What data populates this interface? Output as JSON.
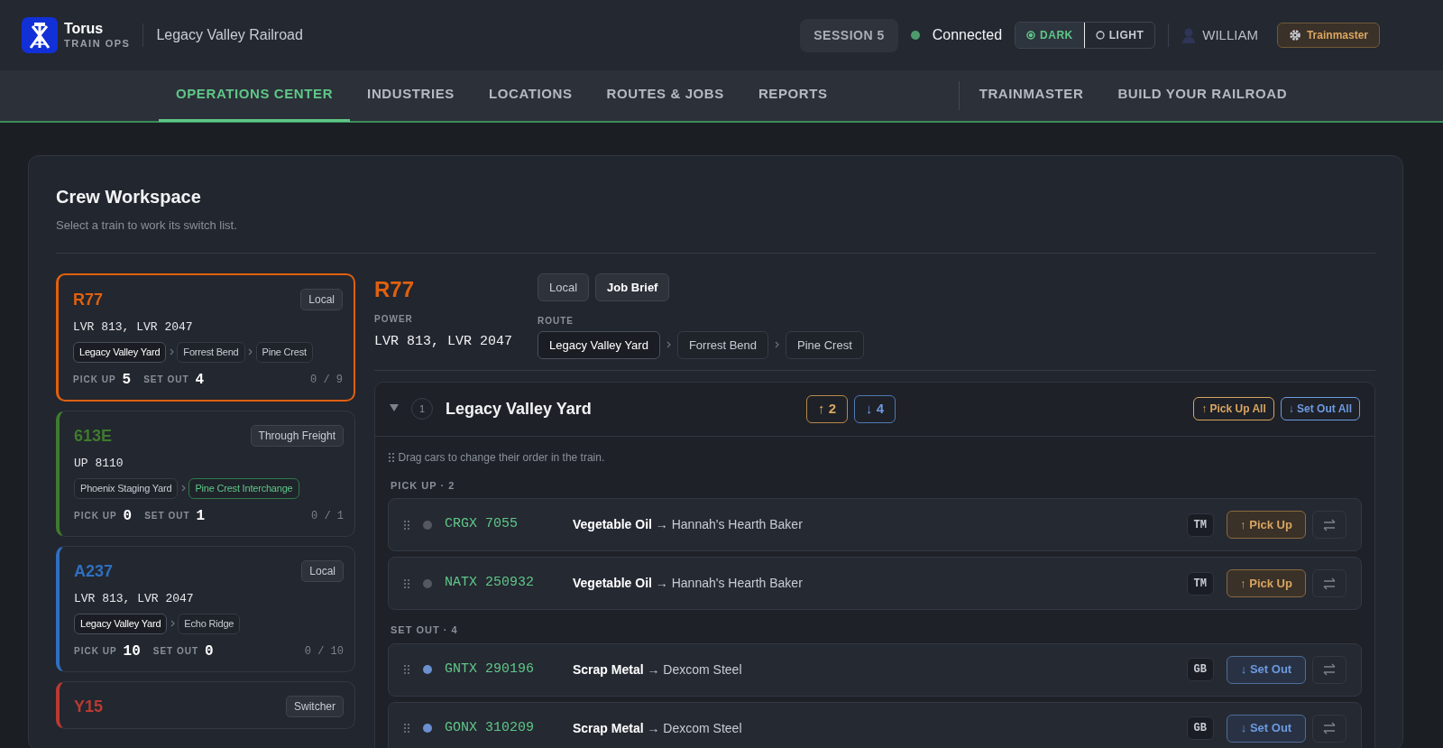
{
  "header": {
    "logo": {
      "title": "Torus",
      "subtitle": "TRAIN OPS"
    },
    "railroad": "Legacy Valley Railroad",
    "session": "SESSION 5",
    "connection": {
      "label": "Connected",
      "on": true
    },
    "theme_toggle": [
      {
        "label": "DARK",
        "selected": true
      },
      {
        "label": "LIGHT",
        "selected": false
      }
    ],
    "user": "WILLIAM",
    "role_button": "Trainmaster"
  },
  "nav": {
    "main": [
      {
        "label": "OPERATIONS CENTER",
        "selected": true
      },
      {
        "label": "INDUSTRIES",
        "selected": false
      },
      {
        "label": "LOCATIONS",
        "selected": false
      },
      {
        "label": "ROUTES & JOBS",
        "selected": false
      },
      {
        "label": "REPORTS",
        "selected": false
      }
    ],
    "admin": [
      {
        "label": "TRAINMASTER",
        "selected": false
      },
      {
        "label": "BUILD YOUR RAILROAD",
        "selected": false
      }
    ]
  },
  "workspace": {
    "title": "Crew Workspace",
    "subtitle": "Select a train to work its switch list."
  },
  "trains": [
    {
      "name": "R77",
      "color": "#e0600f",
      "type": "Local",
      "selected": true,
      "power": "LVR 813, LVR 2047",
      "route": [
        {
          "label": "Legacy Valley Yard",
          "kind": "current"
        },
        {
          "label": "Forrest Bend",
          "kind": "stop"
        },
        {
          "label": "Pine Crest",
          "kind": "stop"
        }
      ],
      "pickup_label": "PICK UP",
      "pickup": "5",
      "setout_label": "SET OUT",
      "setout": "4",
      "progress": "0 / 9"
    },
    {
      "name": "613E",
      "color": "#3f7a2e",
      "type": "Through Freight",
      "selected": false,
      "power": "UP 8110",
      "route": [
        {
          "label": "Phoenix Staging Yard",
          "kind": "stop"
        },
        {
          "label": "Pine Crest Interchange",
          "kind": "interchange"
        }
      ],
      "pickup_label": "PICK UP",
      "pickup": "0",
      "setout_label": "SET OUT",
      "setout": "1",
      "progress": "0 / 1"
    },
    {
      "name": "A237",
      "color": "#2f6fc0",
      "type": "Local",
      "selected": false,
      "power": "LVR 813, LVR 2047",
      "route": [
        {
          "label": "Legacy Valley Yard",
          "kind": "current"
        },
        {
          "label": "Echo Ridge",
          "kind": "stop"
        }
      ],
      "pickup_label": "PICK UP",
      "pickup": "10",
      "setout_label": "SET OUT",
      "setout": "0",
      "progress": "0 / 10"
    },
    {
      "name": "Y15",
      "color": "#b83a32",
      "type": "Switcher",
      "selected": false
    }
  ],
  "detail": {
    "name": "R77",
    "color": "#e0600f",
    "type": "Local",
    "brief_button": "Job Brief",
    "power_label": "POWER",
    "power": "LVR 813, LVR 2047",
    "route_label": "ROUTE",
    "route": [
      {
        "label": "Legacy Valley Yard",
        "kind": "current"
      },
      {
        "label": "Forrest Bend",
        "kind": "stop"
      },
      {
        "label": "Pine Crest",
        "kind": "stop"
      }
    ],
    "stops": [
      {
        "number": "1",
        "name": "Legacy Valley Yard",
        "expanded": true,
        "pickup_count": "↑ 2",
        "setout_count": "↓ 4",
        "pickup_all": "↑ Pick Up All",
        "setout_all": "↓ Set Out All",
        "hint": "Drag cars to change their order in the train.",
        "sections": [
          {
            "kind": "pickup",
            "heading": "PICK UP · 2",
            "cars": [
              {
                "reporting": "CRGX 7055",
                "load": "**Vegetable Oil** → Hannah's Hearth Baker",
                "color": "#55585f",
                "tag": "TM",
                "action": "↑ Pick Up"
              },
              {
                "reporting": "NATX 250932",
                "load": "**Vegetable Oil** → Hannah's Hearth Baker",
                "color": "#55585f",
                "tag": "TM",
                "action": "↑ Pick Up"
              }
            ]
          },
          {
            "kind": "setout",
            "heading": "SET OUT · 4",
            "cars": [
              {
                "reporting": "GNTX 290196",
                "load": "**Scrap Metal** → Dexcom Steel",
                "color": "#6a90cf",
                "tag": "GB",
                "action": "↓ Set Out"
              },
              {
                "reporting": "GONX 310209",
                "load": "**Scrap Metal** → Dexcom Steel",
                "color": "#6a90cf",
                "tag": "GB",
                "action": "↓ Set Out"
              }
            ]
          }
        ]
      }
    ]
  }
}
